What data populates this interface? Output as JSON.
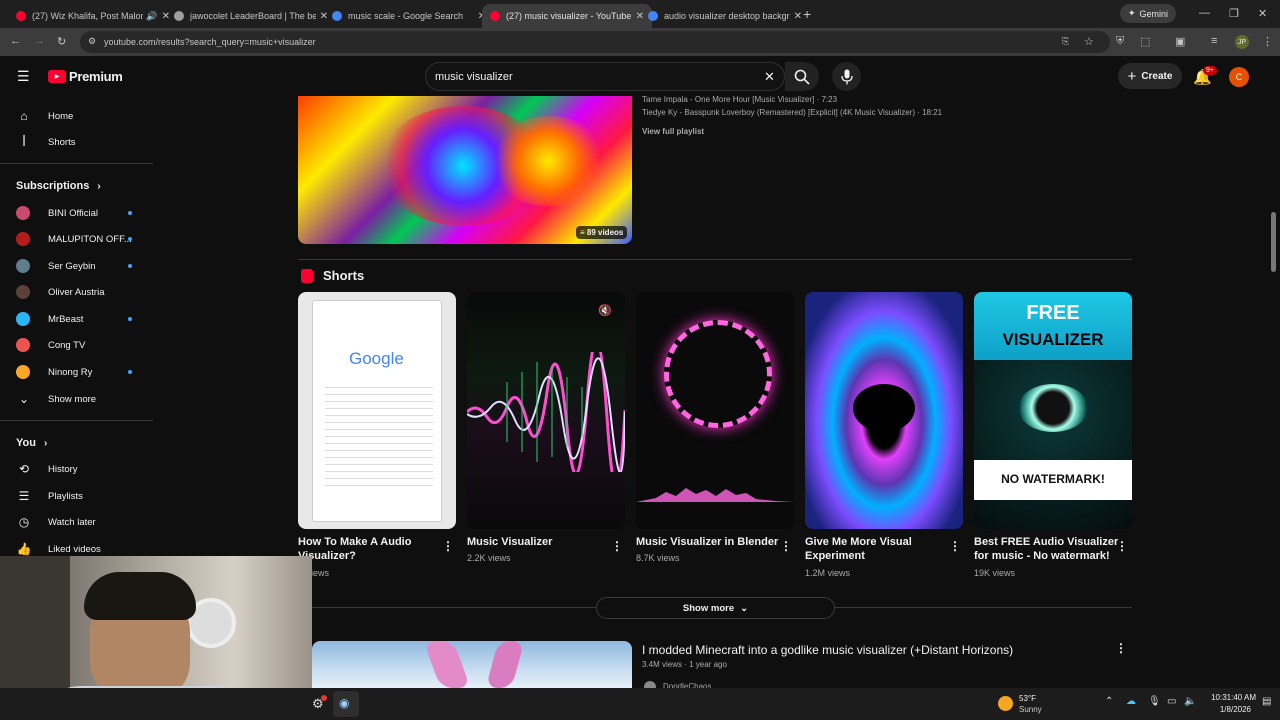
{
  "browser": {
    "tabs": [
      {
        "title": "(27) Wiz Khalifa, Post Malon",
        "color": "#ff0033",
        "active": false
      },
      {
        "title": "jawocolet LeaderBoard | The be",
        "color": "#9aa0a6",
        "active": false
      },
      {
        "title": "music scale - Google Search",
        "color": "#4285f4",
        "active": false
      },
      {
        "title": "(27) music visualizer - YouTube",
        "color": "#ff0033",
        "active": true
      },
      {
        "title": "audio visualizer desktop backgr",
        "color": "#4285f4",
        "active": false
      }
    ],
    "gemini_label": "Gemini",
    "url": "youtube.com/results?search_query=music+visualizer",
    "profile_initials": "JP"
  },
  "youtube": {
    "brand": "Premium",
    "search_value": "music visualizer",
    "create_label": "Create",
    "notif_badge": "9+",
    "avatar_letter": "C"
  },
  "sidebar": {
    "home": "Home",
    "shorts": "Shorts",
    "subscriptions_heading": "Subscriptions",
    "subscriptions": [
      {
        "name": "BINI Official",
        "color": "#c94a6e",
        "new": true
      },
      {
        "name": "MALUPITON OFF...",
        "color": "#b71c1c",
        "new": true
      },
      {
        "name": "Ser Geybin",
        "color": "#607d8b",
        "new": true
      },
      {
        "name": "Oliver Austria",
        "color": "#5d4037",
        "new": false
      },
      {
        "name": "MrBeast",
        "color": "#29b6f6",
        "new": true
      },
      {
        "name": "Cong TV",
        "color": "#ef5350",
        "new": false
      },
      {
        "name": "Ninong Ry",
        "color": "#f9a825",
        "new": true
      }
    ],
    "show_more": "Show more",
    "you_heading": "You",
    "history": "History",
    "playlists": "Playlists",
    "watch_later": "Watch later",
    "liked_videos": "Liked videos"
  },
  "playlist": {
    "items": [
      "Tame Impala - One More Hour [Music Visualizer] · 7:23",
      "Tiedye Ky - Basspunk Loverboy (Remastered) [Explicit] (4K Music Visualizer) · 18:21"
    ],
    "view_full": "View full playlist",
    "count": "89 videos"
  },
  "shorts": {
    "heading": "Shorts",
    "items": [
      {
        "title_line1": "How To Make A Audio",
        "title_line2": "Visualizer?",
        "views": "K views"
      },
      {
        "title_line1": "Music Visualizer",
        "title_line2": "",
        "views": "2.2K views"
      },
      {
        "title_line1": "Music Visualizer in Blender",
        "title_line2": "",
        "views": "8.7K views"
      },
      {
        "title_line1": "Give Me More Visual",
        "title_line2": "Experiment",
        "views": "1.2M views"
      },
      {
        "title_line1": "Best FREE Audio Visualizer",
        "title_line2": "for music - No watermark!",
        "views": "19K views"
      }
    ],
    "thumb_google_text": "Google",
    "thumb5_top1": "FREE",
    "thumb5_top2": "VISUALIZER",
    "thumb5_bottom": "NO WATERMARK!",
    "show_more": "Show more"
  },
  "video": {
    "title": "I modded Minecraft into a godlike music visualizer (+Distant Horizons)",
    "meta": "3.4M views · 1 year ago",
    "channel": "DoodleChaos"
  },
  "taskbar": {
    "temp": "53°F",
    "condition": "Sunny",
    "time": "10:31:40 AM",
    "date": "1/8/2026"
  }
}
